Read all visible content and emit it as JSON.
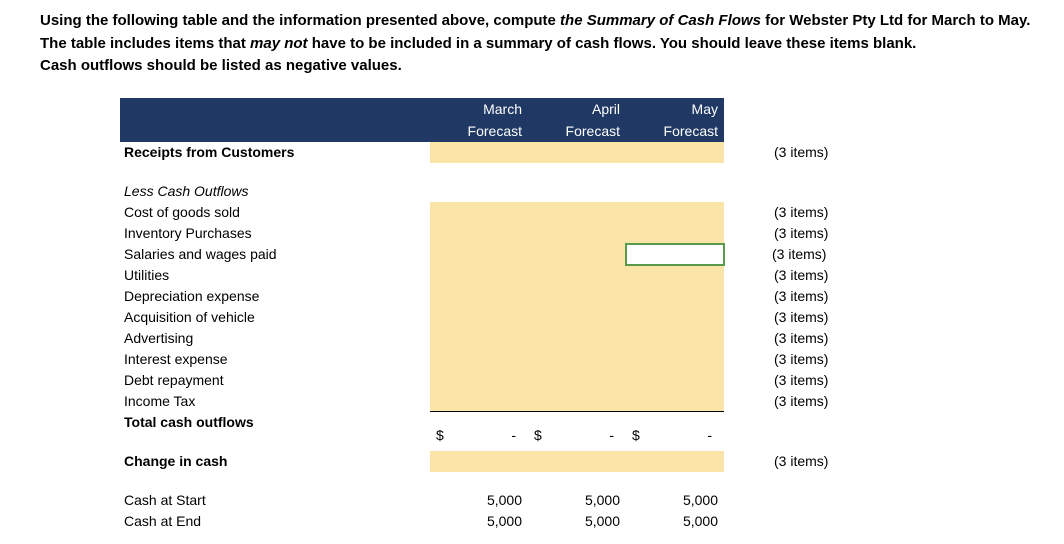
{
  "instructions": {
    "line1_a": "Using the following table and the information presented above, compute ",
    "line1_b": "the Summary of Cash Flows ",
    "line1_c": "for Webster Pty Ltd for March to May.",
    "line2_a": "The table includes items that ",
    "line2_b": "may not",
    "line2_c": " have to be included in a summary of cash flows. You should leave these items blank.",
    "line3": "Cash outflows should be listed as negative values."
  },
  "header": {
    "march_top": "March",
    "march_bot": "Forecast",
    "april_top": "April",
    "april_bot": "Forecast",
    "may_top": "May",
    "may_bot": "Forecast"
  },
  "rows": {
    "receipts": "Receipts from Customers",
    "less_outflows": "Less Cash Outflows",
    "cogs": "Cost of goods sold",
    "inventory": "Inventory Purchases",
    "salaries": "Salaries and wages paid",
    "utilities": "Utilities",
    "depreciation": "Depreciation expense",
    "vehicle": "Acquisition of vehicle",
    "advertising": "Advertising",
    "interest": "Interest expense",
    "debt": "Debt repayment",
    "income_tax": "Income Tax",
    "total_outflows": "Total cash outflows",
    "change_cash": "Change in cash",
    "cash_start": "Cash at Start",
    "cash_end": "Cash at End"
  },
  "hints": {
    "three_items": "(3 items)"
  },
  "totals": {
    "symbol": "$",
    "dash": "-"
  },
  "cash_values": {
    "start_mar": "5,000",
    "start_apr": "5,000",
    "start_may": "5,000",
    "end_mar": "5,000",
    "end_apr": "5,000",
    "end_may": "5,000"
  }
}
